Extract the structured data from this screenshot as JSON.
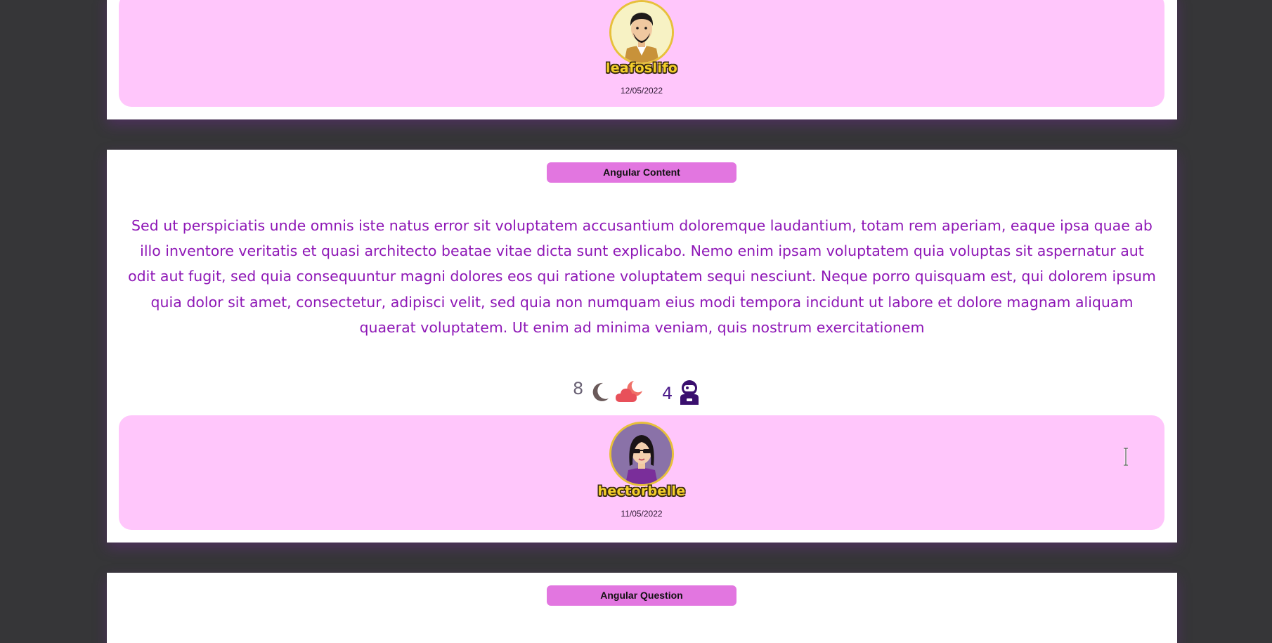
{
  "posts": [
    {
      "author": {
        "username": "leafoslifo",
        "date": "12/05/2022",
        "avatar": "man-beard-avatar-icon"
      }
    },
    {
      "category": "Angular Content",
      "body": "Sed ut perspiciatis unde omnis iste natus error sit voluptatem accusantium doloremque laudantium, totam rem aperiam, eaque ipsa quae ab illo inventore veritatis et quasi architecto beatae vitae dicta sunt explicabo. Nemo enim ipsam voluptatem quia voluptas sit aspernatur aut odit aut fugit, sed quia consequuntur magni dolores eos qui ratione voluptatem sequi nesciunt. Neque porro quisquam est, qui dolorem ipsum quia dolor sit amet, consectetur, adipisci velit, sed quia non numquam eius modi tempora incidunt ut labore et dolore magnam aliquam quaerat voluptatem. Ut enim ad minima veniam, quis nostrum exercitationem",
      "reactions": {
        "moon_count": "8",
        "moon_icon": "crescent-moon-icon",
        "cloud_icon": "cloud-moon-icon",
        "astronaut_count": "4",
        "astronaut_icon": "astronaut-icon"
      },
      "author": {
        "username": "hectorbelle",
        "date": "11/05/2022",
        "avatar": "woman-sunglasses-avatar-icon"
      }
    },
    {
      "category": "Angular Question"
    }
  ],
  "colors": {
    "background": "#363638",
    "card": "#ffffff",
    "author_panel": "#ffc6fb",
    "badge": "#e276e0",
    "body_text": "#8e17b6",
    "username": "#f4cf2a",
    "avatar_ring": "#e7c03b"
  }
}
